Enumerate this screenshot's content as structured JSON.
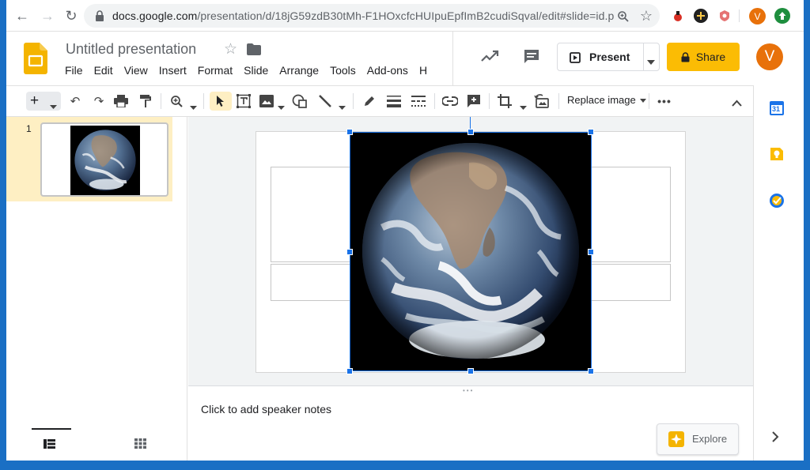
{
  "browser": {
    "url_host": "docs.google.com",
    "url_path": "/presentation/d/18jG59zdB30tMh-F1HOxcfcHUIpuEpfImB2cudiSqval/edit#slide=id.p",
    "profile_initial": "V"
  },
  "doc": {
    "title": "Untitled presentation",
    "menu": [
      "File",
      "Edit",
      "View",
      "Insert",
      "Format",
      "Slide",
      "Arrange",
      "Tools",
      "Add-ons",
      "H"
    ]
  },
  "actions": {
    "present_label": "Present",
    "share_label": "Share",
    "account_initial": "V"
  },
  "toolbar": {
    "replace_image_label": "Replace image"
  },
  "filmstrip": {
    "slide_number": "1"
  },
  "notes": {
    "placeholder": "Click to add speaker notes"
  },
  "explore": {
    "label": "Explore"
  },
  "side_panel": {
    "calendar_day": "31"
  },
  "colors": {
    "accent_blue": "#1a73e8",
    "share_yellow": "#fbbc04",
    "slides_yellow": "#f4b400",
    "avatar_orange": "#e8710a",
    "selected_slide_bg": "#feefc3"
  }
}
